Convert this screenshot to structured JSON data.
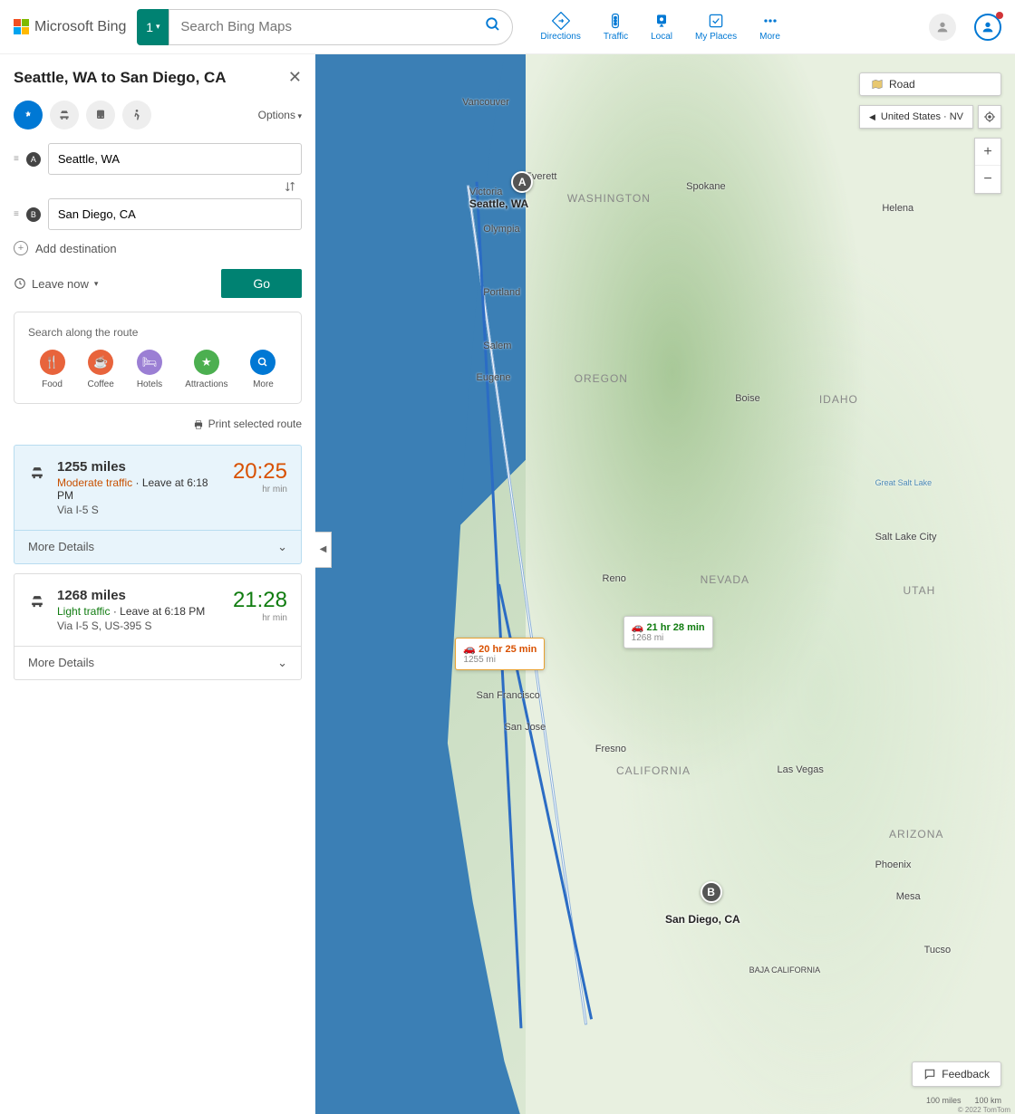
{
  "header": {
    "logo_text": "Microsoft Bing",
    "search_badge": "1",
    "search_placeholder": "Search Bing Maps",
    "nav": {
      "directions": "Directions",
      "traffic": "Traffic",
      "local": "Local",
      "my_places": "My Places",
      "more": "More"
    }
  },
  "panel": {
    "title": "Seattle, WA to San Diego, CA",
    "options_label": "Options",
    "waypoint_a": "Seattle, WA",
    "waypoint_b": "San Diego, CA",
    "add_destination": "Add destination",
    "leave_now": "Leave now",
    "go_button": "Go",
    "search_route_title": "Search along the route",
    "categories": {
      "food": "Food",
      "coffee": "Coffee",
      "hotels": "Hotels",
      "attractions": "Attractions",
      "more": "More"
    },
    "print_label": "Print selected route"
  },
  "routes": [
    {
      "miles": "1255 miles",
      "traffic": "Moderate traffic",
      "leave": "Leave at 6:18 PM",
      "via": "Via I-5 S",
      "time": "20:25",
      "time_unit": "hr  min",
      "details": "More Details",
      "selected": true
    },
    {
      "miles": "1268 miles",
      "traffic": "Light traffic",
      "leave": "Leave at 6:18 PM",
      "via": "Via I-5 S, US-395 S",
      "time": "21:28",
      "time_unit": "hr  min",
      "details": "More Details",
      "selected": false
    }
  ],
  "map": {
    "road_chip": "Road",
    "location_chip": "United States · NV",
    "feedback": "Feedback",
    "scale_mi": "100 miles",
    "scale_km": "100 km",
    "copyright": "© 2022 TomTom",
    "marker_a_label": "Seattle, WA",
    "marker_b_label": "San Diego, CA",
    "tooltip1_time": "20 hr 25 min",
    "tooltip1_dist": "1255 mi",
    "tooltip2_time": "21 hr 28 min",
    "tooltip2_dist": "1268 mi",
    "cities": {
      "vancouver": "Vancouver",
      "victoria": "Victoria",
      "everett": "Everett",
      "olympia": "Olympia",
      "spokane": "Spokane",
      "portland": "Portland",
      "salem": "Salem",
      "eugene": "Eugene",
      "boise": "Boise",
      "helena": "Helena",
      "greatsalt": "Great Salt Lake",
      "slc": "Salt Lake City",
      "reno": "Reno",
      "sanfrancisco": "San Francisco",
      "sanjose": "San Jose",
      "fresno": "Fresno",
      "lasvegas": "Las Vegas",
      "phoenix": "Phoenix",
      "mesa": "Mesa",
      "tucson": "Tucso",
      "baja": "BAJA CALIFORNIA"
    },
    "states": {
      "washington": "WASHINGTON",
      "oregon": "OREGON",
      "idaho": "IDAHO",
      "nevada": "NEVADA",
      "utah": "UTAH",
      "california": "CALIFORNIA",
      "arizona": "ARIZONA"
    }
  }
}
